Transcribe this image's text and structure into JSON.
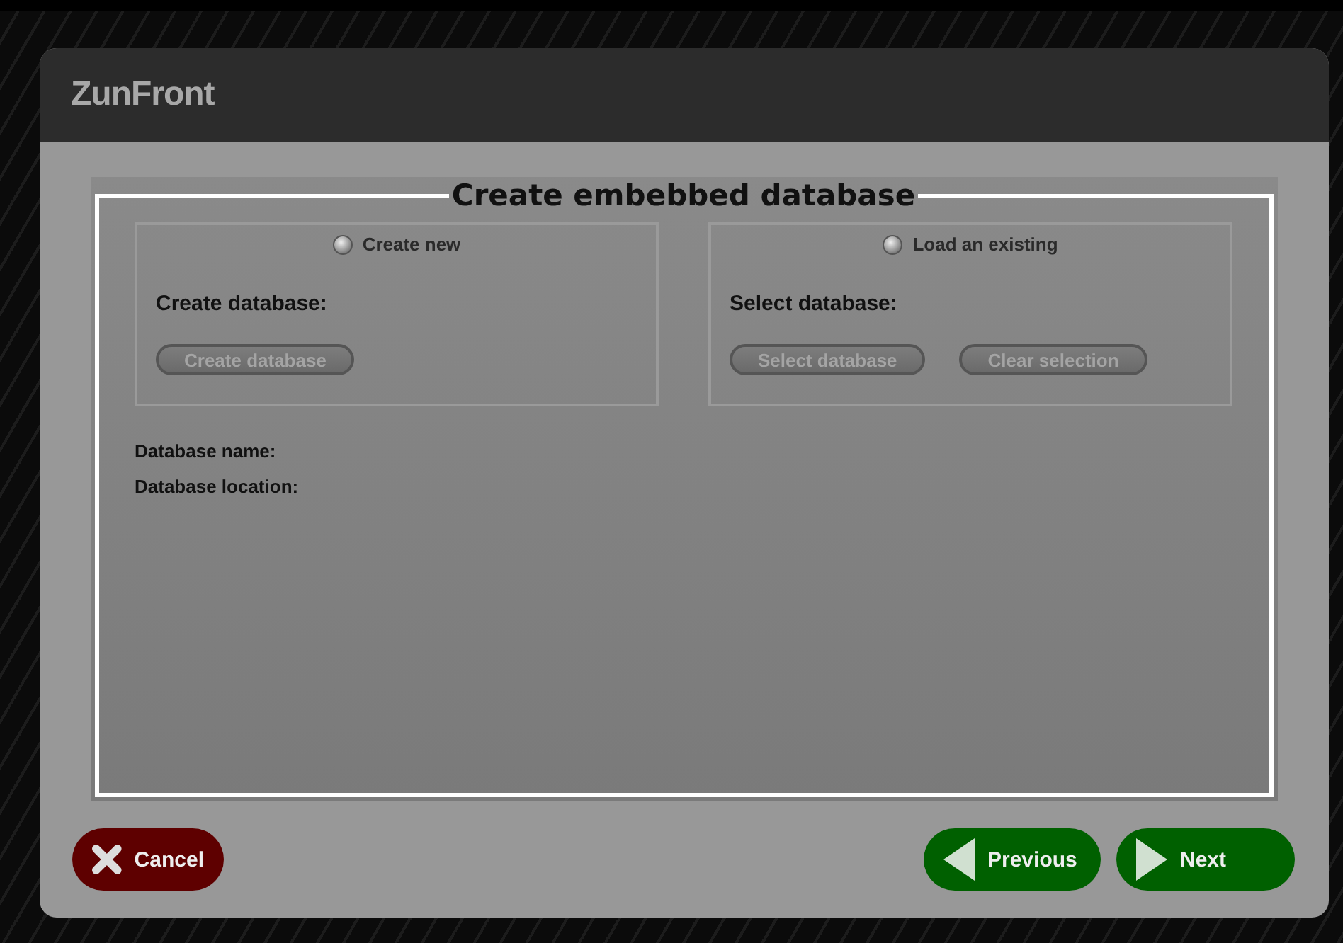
{
  "window": {
    "title": "ZunFront"
  },
  "panel": {
    "title": "Create embebbed database",
    "options": [
      {
        "radio": {
          "label": "Create new",
          "selected": false
        },
        "heading": "Create database:",
        "buttons": [
          {
            "label": "Create database",
            "disabled": true
          }
        ]
      },
      {
        "radio": {
          "label": "Load an existing",
          "selected": false
        },
        "heading": "Select database:",
        "buttons": [
          {
            "label": "Select database",
            "disabled": true
          },
          {
            "label": "Clear selection",
            "disabled": true
          }
        ]
      }
    ],
    "fields": [
      "Database name:",
      "Database location:"
    ]
  },
  "footer": {
    "cancel": "Cancel",
    "previous": "Previous",
    "next": "Next"
  }
}
